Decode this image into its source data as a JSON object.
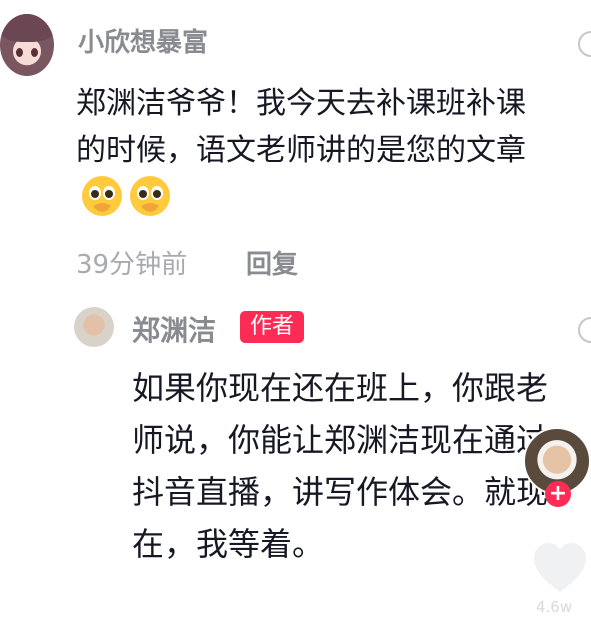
{
  "comment": {
    "user_name": "小欣想暴富",
    "text": "郑渊洁爷爷！我今天去补课班补课的时候，语文老师讲的是您的文章",
    "emojis": [
      "pleading-face-emoji",
      "pleading-face-emoji"
    ],
    "time": "39分钟前",
    "reply_label": "回复"
  },
  "reply": {
    "user_name": "郑渊洁",
    "badge": "作者",
    "text": "如果你现在还在班上，你跟老师说，你能让郑渊洁现在通过抖音直播，讲写作体会。就现在，我等着。"
  },
  "sidebar": {
    "follow_icon": "+",
    "like_count": "4.6w"
  },
  "colors": {
    "accent": "#fe2c55",
    "name_gray": "#8a8b91",
    "meta_gray": "#a9aab0",
    "text": "#161823"
  }
}
